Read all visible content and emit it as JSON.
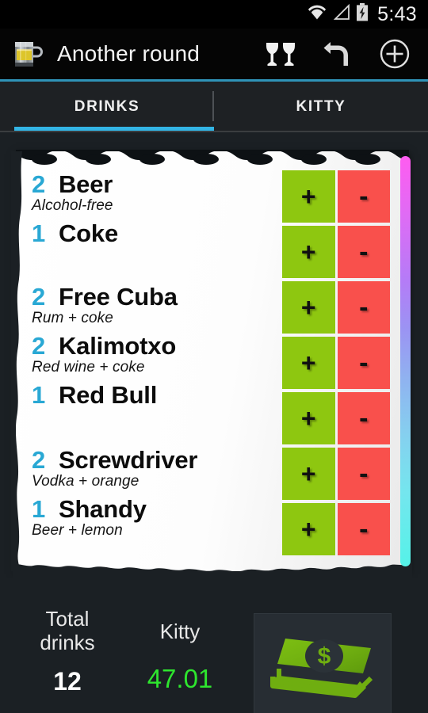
{
  "statusbar": {
    "time": "5:43",
    "icons": [
      "wifi-icon",
      "signal-icon",
      "battery-charging-icon"
    ]
  },
  "actionbar": {
    "app_icon": "beer-mug-icon",
    "title": "Another round",
    "actions": [
      {
        "name": "cheers-toast-icon",
        "label": "Cheers"
      },
      {
        "name": "undo-icon",
        "label": "Undo"
      },
      {
        "name": "add-circle-icon",
        "label": "Add"
      }
    ]
  },
  "tabs": {
    "items": [
      {
        "label": "DRINKS",
        "selected": true
      },
      {
        "label": "KITTY",
        "selected": false
      }
    ],
    "indicator_color": "#33b5e5"
  },
  "colors": {
    "accent_blue": "#33b5e5",
    "count_blue": "#29a8d4",
    "plus_green": "#8ec710",
    "minus_red": "#f9504c",
    "kitty_green": "#2ee62e",
    "paper_white": "#ffffff",
    "background_dark": "#1b2024"
  },
  "drinks": [
    {
      "qty": "2",
      "name": "Beer",
      "subtitle": "Alcohol-free"
    },
    {
      "qty": "1",
      "name": "Coke",
      "subtitle": ""
    },
    {
      "qty": "2",
      "name": "Free Cuba",
      "subtitle": "Rum + coke"
    },
    {
      "qty": "2",
      "name": "Kalimotxo",
      "subtitle": "Red wine + coke"
    },
    {
      "qty": "1",
      "name": "Red Bull",
      "subtitle": ""
    },
    {
      "qty": "2",
      "name": "Screwdriver",
      "subtitle": "Vodka + orange"
    },
    {
      "qty": "1",
      "name": "Shandy",
      "subtitle": "Beer + lemon"
    }
  ],
  "stepper": {
    "plus_label": "+",
    "minus_label": "-"
  },
  "summary": {
    "total_label_line1": "Total",
    "total_label_line2": "drinks",
    "total_value": "12",
    "kitty_label": "Kitty",
    "kitty_value": "47.01",
    "money_button_icon": "money-stack-icon"
  }
}
